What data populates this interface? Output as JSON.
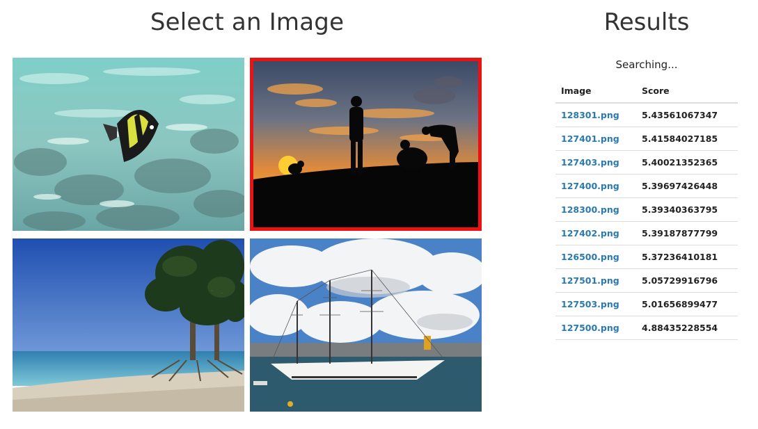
{
  "select_panel": {
    "title": "Select an Image",
    "images": [
      {
        "description_icon": "fish-photo",
        "selected": false
      },
      {
        "description_icon": "sunset-silhouette-photo",
        "selected": true
      },
      {
        "description_icon": "beach-trees-photo",
        "selected": false
      },
      {
        "description_icon": "tall-ship-photo",
        "selected": false
      }
    ]
  },
  "results_panel": {
    "title": "Results",
    "status": "Searching...",
    "columns": [
      "Image",
      "Score"
    ],
    "rows": [
      {
        "image": "128301.png",
        "score": "5.43561067347"
      },
      {
        "image": "127401.png",
        "score": "5.41584027185"
      },
      {
        "image": "127403.png",
        "score": "5.40021352365"
      },
      {
        "image": "127400.png",
        "score": "5.39697426448"
      },
      {
        "image": "128300.png",
        "score": "5.39340363795"
      },
      {
        "image": "127402.png",
        "score": "5.39187877799"
      },
      {
        "image": "126500.png",
        "score": "5.37236410181"
      },
      {
        "image": "127501.png",
        "score": "5.05729916796"
      },
      {
        "image": "127503.png",
        "score": "5.01656899477"
      },
      {
        "image": "127500.png",
        "score": "4.88435228554"
      }
    ]
  },
  "colors": {
    "selected_border": "#ee1111",
    "link": "#2a7ab0"
  }
}
